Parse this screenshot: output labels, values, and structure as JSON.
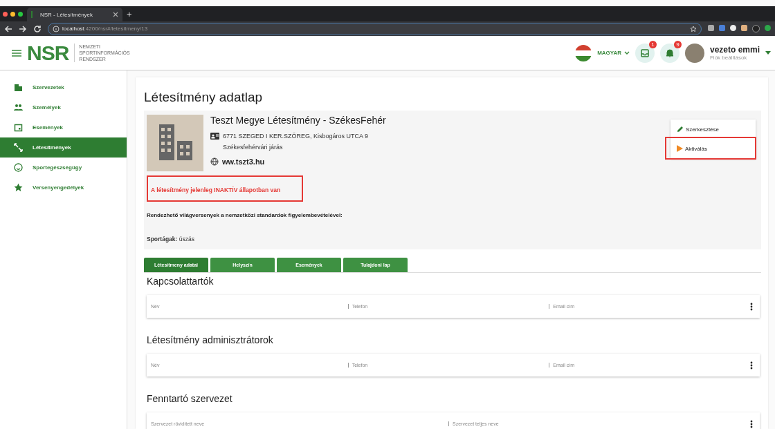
{
  "browser": {
    "tab_title": "NSR - Létesítmények",
    "new_tab": "+",
    "url_host": "localhost",
    "url_path": ":4200/nsr#/letesitmeny/13"
  },
  "header": {
    "logo": "NSR",
    "logo_lines": [
      "NEMZETI",
      "SPORTINFORMÁCIÓS",
      "RENDSZER"
    ],
    "language": "MAGYAR",
    "inbox_badge": "1",
    "bell_badge": "9",
    "user_name": "vezeto emmi",
    "user_sub": "Fiók beálltások"
  },
  "sidebar": {
    "items": [
      {
        "label": "Szervezetek",
        "kind": "org",
        "selected": false
      },
      {
        "label": "Személyek",
        "kind": "people",
        "selected": false
      },
      {
        "label": "Események",
        "kind": "event",
        "selected": false
      },
      {
        "label": "Létesítmények",
        "kind": "facility",
        "selected": true
      },
      {
        "label": "Sportegészségügy",
        "kind": "health",
        "selected": false
      },
      {
        "label": "Versenyengedélyek",
        "kind": "star",
        "selected": false
      }
    ]
  },
  "page": {
    "title": "Létesítmény adatlap",
    "facility_name": "Teszt Megye Létesítmény - SzékesFehér",
    "address": "6771 SZEGED I KER.SZÖREG, Kisbogáros UTCA 9",
    "district": "Székesfehérvári járás",
    "website": "ww.tszt3.hu",
    "status_notice": "A létesítmény jelenleg INAKTÍV állapotban van",
    "competitions": "Rendezhető világversenyek a nemzetközi standardok figyelembevételével:",
    "sports": "**Sportágak:** úszás"
  },
  "actions": [
    {
      "label": "Szerkesztése",
      "kind": "edit"
    },
    {
      "label": "Aktiválás",
      "kind": "activate"
    }
  ],
  "tabs": [
    {
      "label": "Létesítmeny adatai",
      "selected": true
    },
    {
      "label": "Helyszín",
      "selected": false
    },
    {
      "label": "Események",
      "selected": false
    },
    {
      "label": "Tulajdoni lap",
      "selected": false
    }
  ],
  "sections": [
    {
      "title": "Kapcsolattartók",
      "columns": [
        "Név",
        "Telefon",
        "Email cím"
      ]
    },
    {
      "title": "Létesítmény adminisztrátorok",
      "columns": [
        "Név",
        "Telefon",
        "Email cím"
      ]
    },
    {
      "title": "Fenntartó szervezet",
      "columns": [
        "Szervezet rövidített neve",
        "Szervezet teljes neve"
      ]
    }
  ]
}
